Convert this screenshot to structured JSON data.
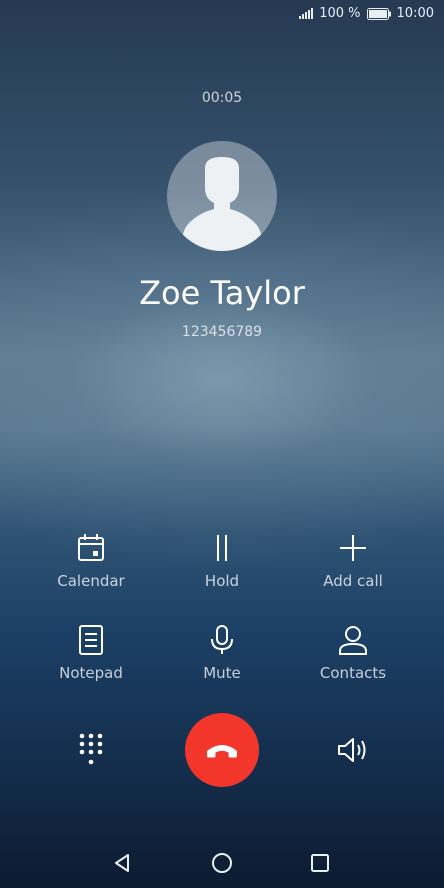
{
  "status_bar": {
    "battery": "100 %",
    "time": "10:00"
  },
  "call": {
    "duration": "00:05",
    "contact_name": "Zoe Taylor",
    "contact_number": "123456789"
  },
  "actions": [
    {
      "label": "Calendar",
      "icon": "calendar-icon"
    },
    {
      "label": "Hold",
      "icon": "pause-icon"
    },
    {
      "label": "Add call",
      "icon": "plus-icon"
    },
    {
      "label": "Notepad",
      "icon": "notepad-icon"
    },
    {
      "label": "Mute",
      "icon": "microphone-icon"
    },
    {
      "label": "Contacts",
      "icon": "person-icon"
    }
  ],
  "bottom_controls": {
    "keypad_icon": "dialpad-icon",
    "end_call_icon": "phone-hangup-icon",
    "speaker_icon": "speaker-icon",
    "end_call_color": "#f2362b"
  },
  "navigation": {
    "back_icon": "back-triangle-icon",
    "home_icon": "home-circle-icon",
    "recents_icon": "recents-square-icon"
  }
}
